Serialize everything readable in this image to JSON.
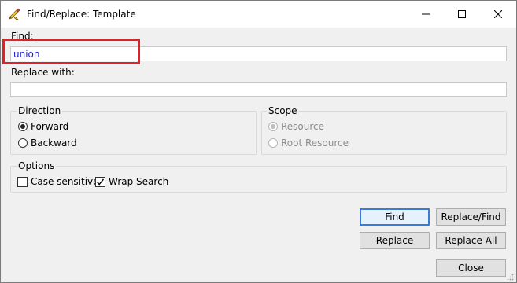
{
  "window": {
    "title": "Find/Replace: Template"
  },
  "find": {
    "label": "Find:",
    "value": "union"
  },
  "replace": {
    "label": "Replace with:",
    "value": ""
  },
  "direction": {
    "title": "Direction",
    "options": [
      {
        "label": "Forward",
        "selected": true
      },
      {
        "label": "Backward",
        "selected": false
      }
    ]
  },
  "scope": {
    "title": "Scope",
    "options": [
      {
        "label": "Resource",
        "selected": true,
        "disabled": true
      },
      {
        "label": "Root Resource",
        "selected": false,
        "disabled": true
      }
    ]
  },
  "options": {
    "title": "Options",
    "case_sensitive": {
      "label": "Case sensitive",
      "checked": false
    },
    "wrap_search": {
      "label": "Wrap Search",
      "checked": true
    }
  },
  "buttons": {
    "find": "Find",
    "replace_find": "Replace/Find",
    "replace": "Replace",
    "replace_all": "Replace All",
    "close": "Close"
  },
  "colors": {
    "find_text": "#1f1fc8",
    "highlight": "#e0202a",
    "default_button_border": "#3a7bd5"
  }
}
